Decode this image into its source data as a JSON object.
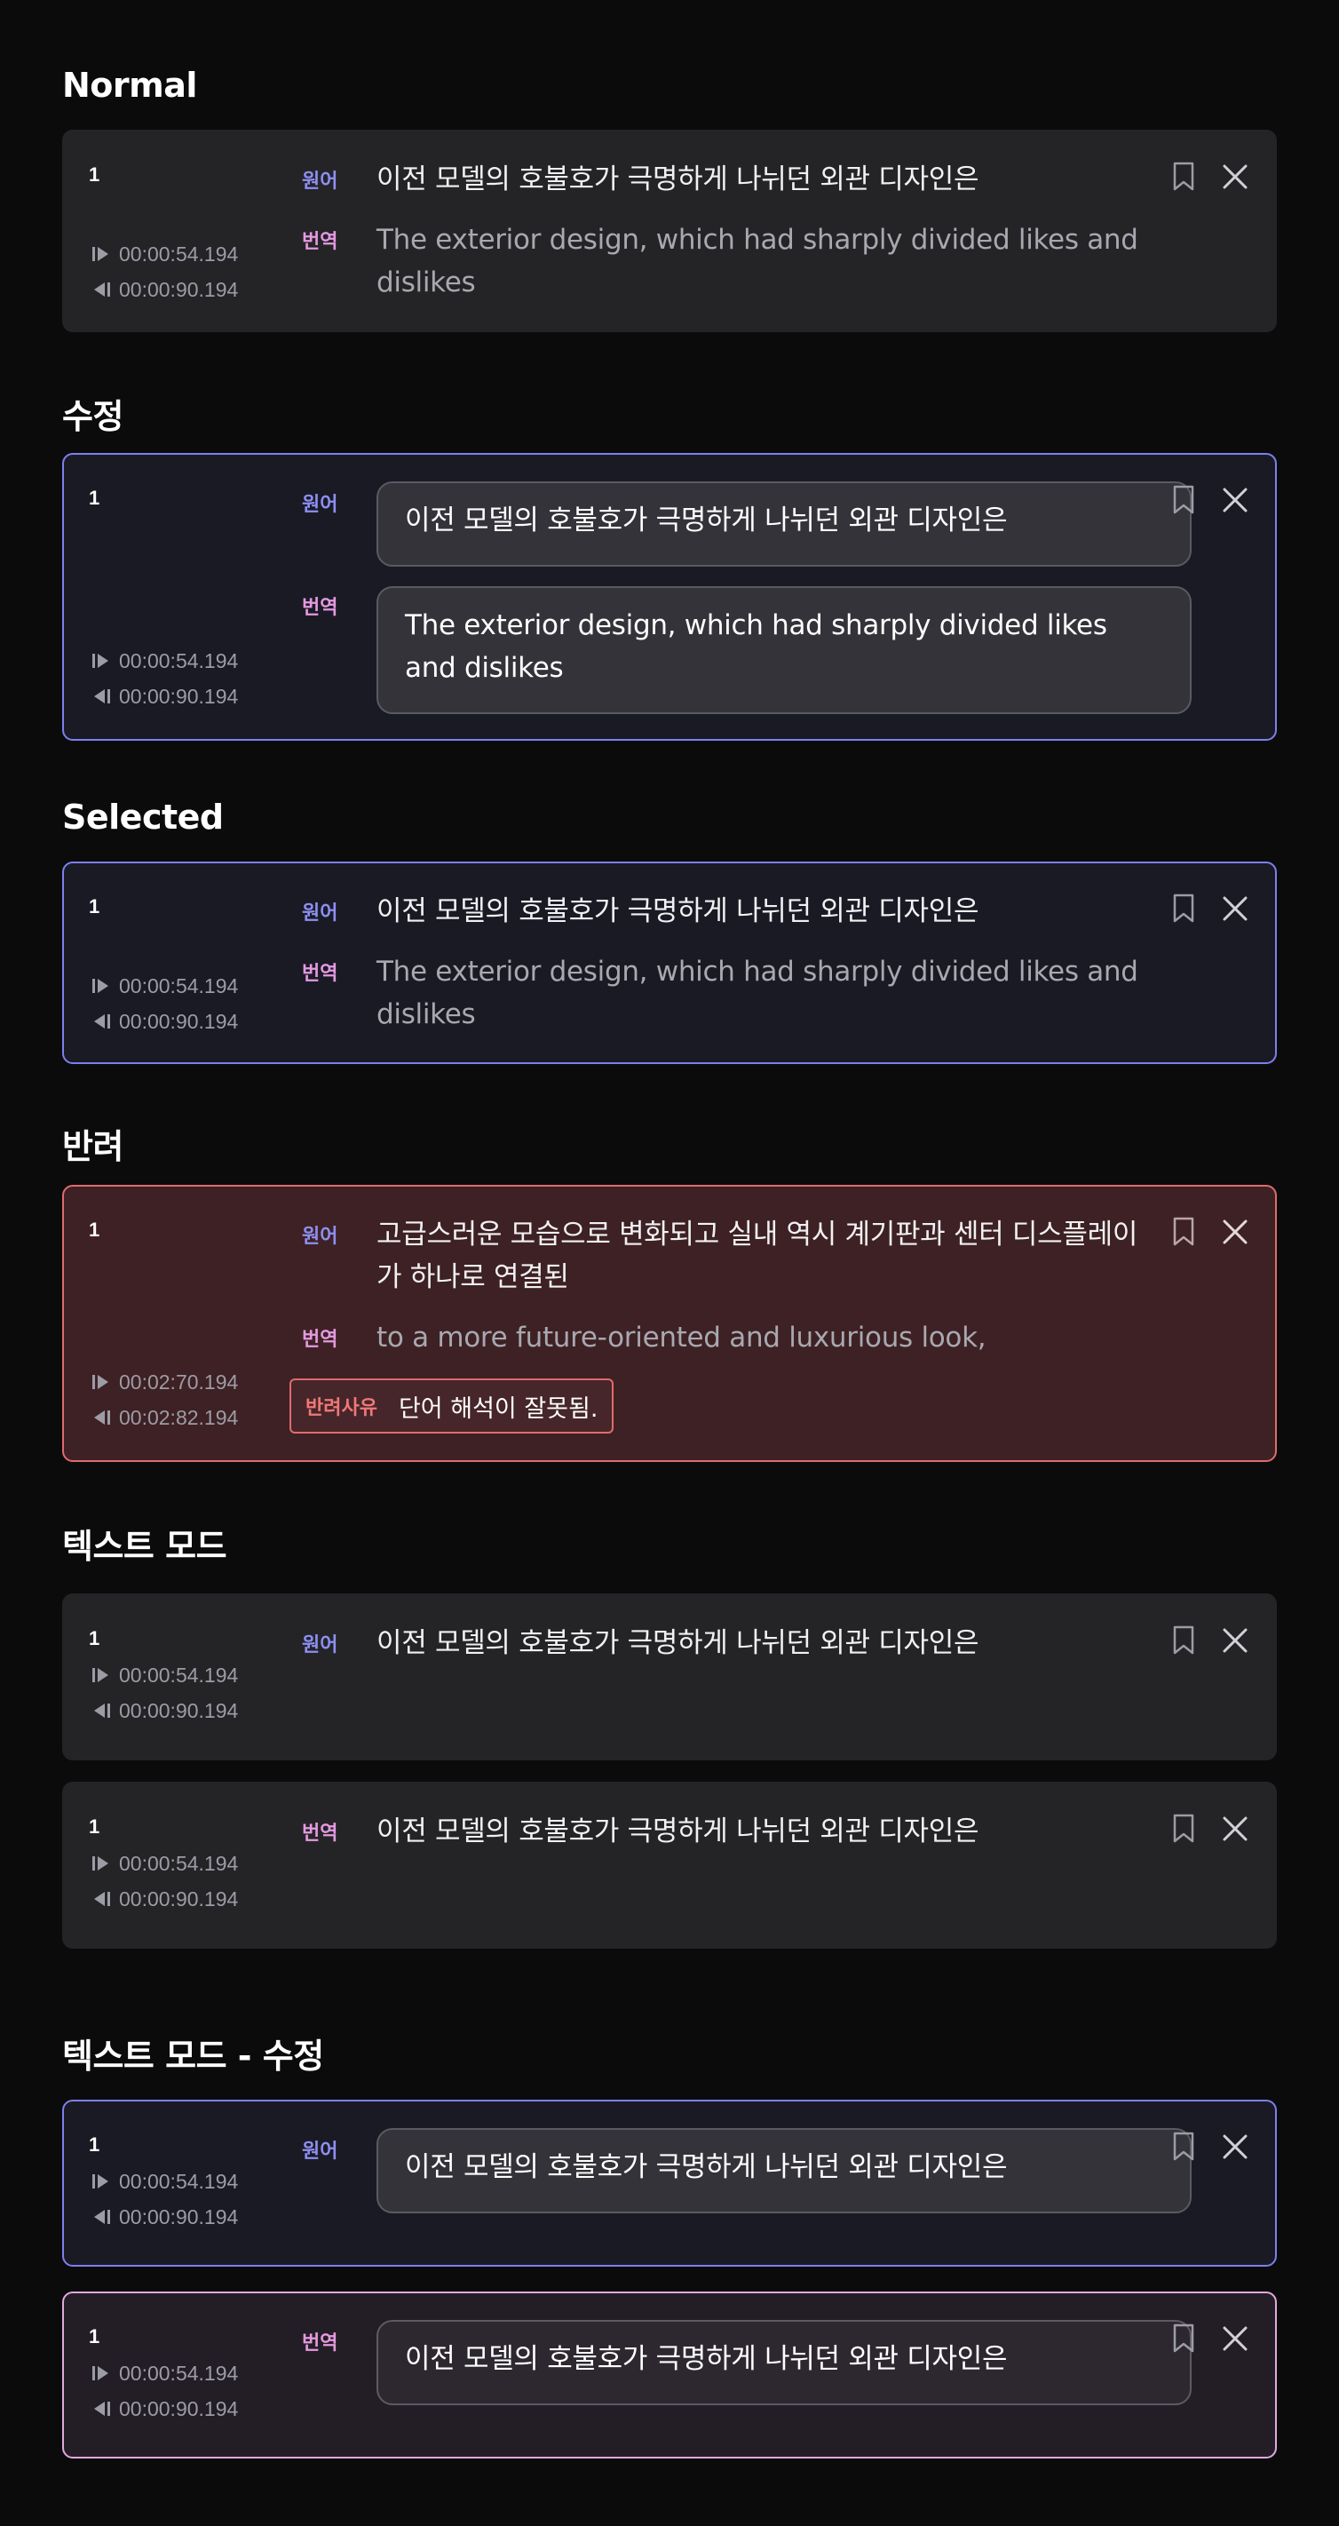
{
  "labels": {
    "source_tag": "원어",
    "translation_tag": "번역",
    "reject_reason_label": "반려사유"
  },
  "icons": {
    "play_start": "play-start-icon",
    "play_end": "play-end-icon",
    "bookmark": "bookmark-icon",
    "close": "close-icon"
  },
  "colors": {
    "background": "#0b0b0c",
    "card": "#242427",
    "selected_border": "#7d80ee",
    "rejected_border": "#e06b6b",
    "source_tag": "#8e8ff2",
    "translation_tag": "#e49ae0"
  },
  "sections": {
    "normal": {
      "title": "Normal",
      "index": "1",
      "start": "00:00:54.194",
      "end": "00:00:90.194",
      "source": "이전 모델의 호불호가 극명하게 나뉘던 외관 디자인은",
      "translation": "The exterior design, which had sharply divided likes and dislikes"
    },
    "edit": {
      "title": "수정",
      "index": "1",
      "start": "00:00:54.194",
      "end": "00:00:90.194",
      "source": "이전 모델의 호불호가 극명하게 나뉘던 외관 디자인은",
      "translation": "The exterior design, which had sharply divided likes and dislikes"
    },
    "selected": {
      "title": "Selected",
      "index": "1",
      "start": "00:00:54.194",
      "end": "00:00:90.194",
      "source": "이전 모델의 호불호가 극명하게 나뉘던 외관 디자인은",
      "translation": "The exterior design, which had sharply divided likes and dislikes"
    },
    "rejected": {
      "title": "반려",
      "index": "1",
      "start": "00:02:70.194",
      "end": "00:02:82.194",
      "source": "고급스러운 모습으로 변화되고 실내 역시 계기판과 센터 디스플레이가 하나로 연결된",
      "translation": "to a more future-oriented and luxurious look,",
      "reject_reason": "단어 해석이 잘못됨."
    },
    "text_mode": {
      "title": "텍스트 모드",
      "source_card": {
        "index": "1",
        "start": "00:00:54.194",
        "end": "00:00:90.194",
        "text": "이전 모델의 호불호가 극명하게 나뉘던 외관 디자인은"
      },
      "translation_card": {
        "index": "1",
        "start": "00:00:54.194",
        "end": "00:00:90.194",
        "text": "이전 모델의 호불호가 극명하게 나뉘던 외관 디자인은"
      }
    },
    "text_mode_edit": {
      "title": "텍스트 모드 - 수정",
      "source_card": {
        "index": "1",
        "start": "00:00:54.194",
        "end": "00:00:90.194",
        "text": "이전 모델의 호불호가 극명하게 나뉘던 외관 디자인은"
      },
      "translation_card": {
        "index": "1",
        "start": "00:00:54.194",
        "end": "00:00:90.194",
        "text": "이전 모델의 호불호가 극명하게 나뉘던 외관 디자인은"
      }
    }
  }
}
